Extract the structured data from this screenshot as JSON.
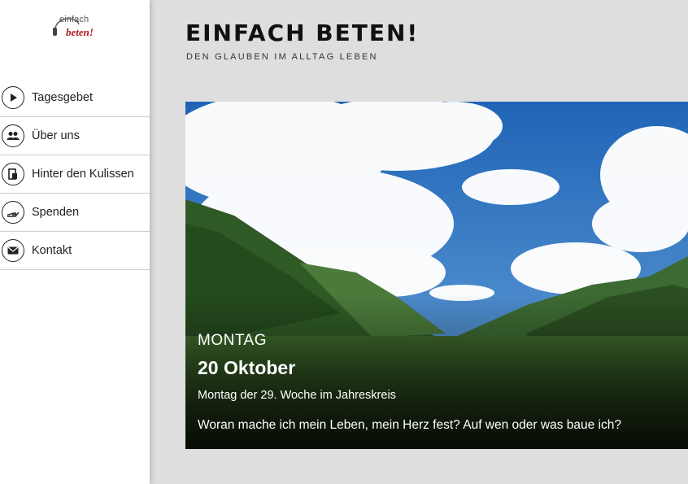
{
  "logo": {
    "line1": "einfach",
    "line2": "beten!"
  },
  "nav": [
    {
      "label": "Tagesgebet",
      "icon": "play-icon"
    },
    {
      "label": "Über uns",
      "icon": "users-icon"
    },
    {
      "label": "Hinter den Kulissen",
      "icon": "door-icon"
    },
    {
      "label": "Spenden",
      "icon": "donate-hand-icon"
    },
    {
      "label": "Kontakt",
      "icon": "envelope-icon"
    }
  ],
  "header": {
    "title": "EINFACH BETEN!",
    "subtitle": "DEN GLAUBEN IM ALLTAG LEBEN"
  },
  "hero": {
    "day": "MONTAG",
    "date": "20 Oktober",
    "liturgy": "Montag der 29. Woche im Jahreskreis",
    "question": "Woran mache ich mein Leben, mein Herz fest? Auf wen oder was baue ich?"
  },
  "colors": {
    "sidebar_bg": "#ffffff",
    "page_bg": "#dedede",
    "brand_red": "#b01822",
    "text_dark": "#111111"
  }
}
